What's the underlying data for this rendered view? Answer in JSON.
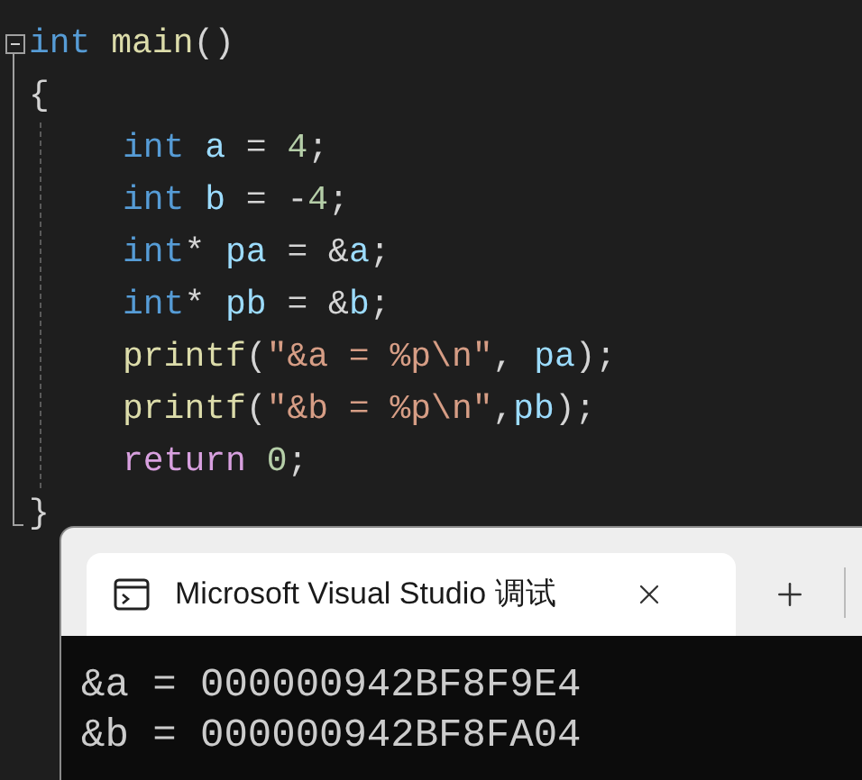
{
  "editor": {
    "lines": [
      {
        "tokens": [
          {
            "kind": "keyword",
            "text": "int "
          },
          {
            "kind": "func",
            "text": "main"
          },
          {
            "kind": "plain",
            "text": "()"
          }
        ]
      },
      {
        "tokens": [
          {
            "kind": "plain",
            "text": "{"
          }
        ],
        "children": [
          {
            "tokens": [
              {
                "kind": "keyword",
                "text": "int "
              },
              {
                "kind": "ident",
                "text": "a"
              },
              {
                "kind": "plain",
                "text": " = "
              },
              {
                "kind": "number",
                "text": "4"
              },
              {
                "kind": "plain",
                "text": ";"
              }
            ]
          },
          {
            "tokens": [
              {
                "kind": "keyword",
                "text": "int "
              },
              {
                "kind": "ident",
                "text": "b"
              },
              {
                "kind": "plain",
                "text": " = -"
              },
              {
                "kind": "number",
                "text": "4"
              },
              {
                "kind": "plain",
                "text": ";"
              }
            ]
          },
          {
            "tokens": [
              {
                "kind": "keyword",
                "text": "int"
              },
              {
                "kind": "plain",
                "text": "* "
              },
              {
                "kind": "ident",
                "text": "pa"
              },
              {
                "kind": "plain",
                "text": " = &"
              },
              {
                "kind": "ident",
                "text": "a"
              },
              {
                "kind": "plain",
                "text": ";"
              }
            ]
          },
          {
            "tokens": [
              {
                "kind": "keyword",
                "text": "int"
              },
              {
                "kind": "plain",
                "text": "* "
              },
              {
                "kind": "ident",
                "text": "pb"
              },
              {
                "kind": "plain",
                "text": " = &"
              },
              {
                "kind": "ident",
                "text": "b"
              },
              {
                "kind": "plain",
                "text": ";"
              }
            ]
          },
          {
            "tokens": [
              {
                "kind": "func",
                "text": "printf"
              },
              {
                "kind": "plain",
                "text": "("
              },
              {
                "kind": "string",
                "text": "\"&a = %p\\n\""
              },
              {
                "kind": "plain",
                "text": ", "
              },
              {
                "kind": "ident",
                "text": "pa"
              },
              {
                "kind": "plain",
                "text": ");"
              }
            ]
          },
          {
            "tokens": [
              {
                "kind": "func",
                "text": "printf"
              },
              {
                "kind": "plain",
                "text": "("
              },
              {
                "kind": "string",
                "text": "\"&b = %p\\n\""
              },
              {
                "kind": "plain",
                "text": ","
              },
              {
                "kind": "ident",
                "text": "pb"
              },
              {
                "kind": "plain",
                "text": ");"
              }
            ]
          },
          {
            "tokens": [
              {
                "kind": "control",
                "text": "return "
              },
              {
                "kind": "number",
                "text": "0"
              },
              {
                "kind": "plain",
                "text": ";"
              }
            ]
          }
        ]
      },
      {
        "tokens": [
          {
            "kind": "plain",
            "text": "}"
          }
        ]
      }
    ]
  },
  "terminal": {
    "tab": {
      "title": "Microsoft Visual Studio 调试",
      "selected": true
    },
    "output": [
      "&a = 000000942BF8F9E4",
      "&b = 000000942BF8FA04"
    ]
  }
}
